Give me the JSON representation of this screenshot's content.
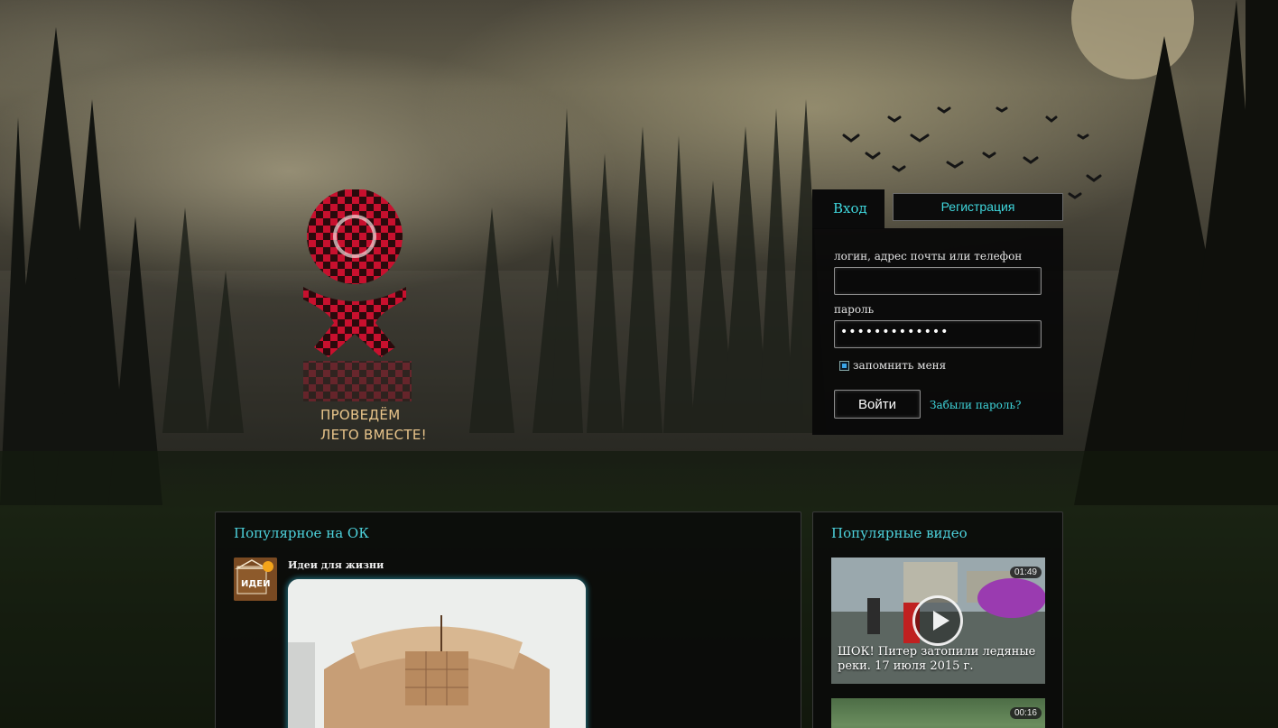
{
  "login": {
    "tab_login": "Вход",
    "tab_register": "Регистрация",
    "login_label": "логин, адрес почты или телефон",
    "login_value": "",
    "password_label": "пароль",
    "password_value": "•••••••••••••",
    "remember_label": "запомнить меня",
    "submit_label": "Войти",
    "forgot_label": "Забыли пароль?"
  },
  "promo": {
    "line1": "ПРОВЕДЁМ",
    "line2": "ЛЕТО ВМЕСТЕ!"
  },
  "popular": {
    "title": "Популярное на ОК",
    "group_name": "Идеи для жизни",
    "avatar_text": "ИДЕИ"
  },
  "videos": {
    "title": "Популярные видео",
    "items": [
      {
        "duration": "01:49",
        "caption": "ШОК! Питер затопили ледяные реки. 17 июля 2015 г."
      },
      {
        "duration": "00:16"
      }
    ]
  },
  "colors": {
    "accent": "#3fd6dc",
    "logo_red": "#c8102e",
    "promo_text": "#e8c48a"
  }
}
